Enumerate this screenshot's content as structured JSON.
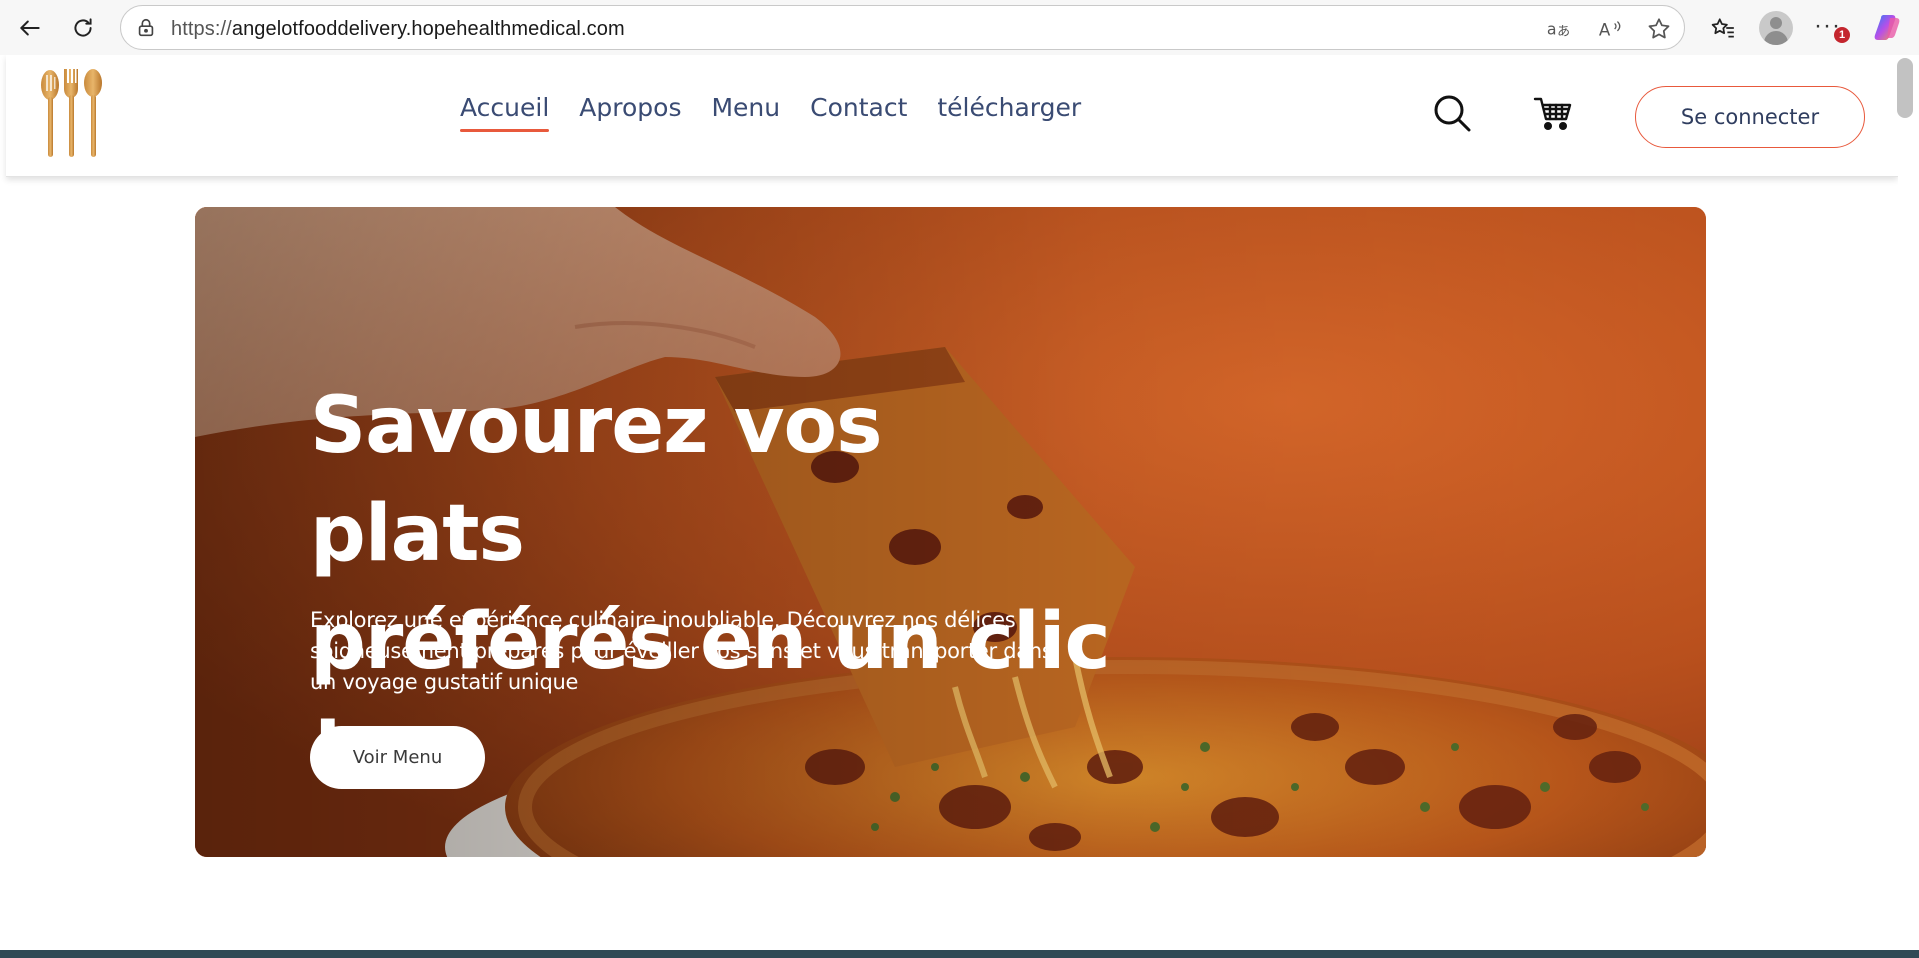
{
  "browser": {
    "url_prefix": "https://",
    "url_host": "angelotfooddelivery.hopehealthmedical.com",
    "notification_count": "1",
    "icons": [
      "back-icon",
      "refresh-icon",
      "lock-icon",
      "translate-icon",
      "read-aloud-icon",
      "favorite-star-icon",
      "favorites-icon",
      "profile-icon",
      "more-icon",
      "copilot-icon"
    ]
  },
  "header": {
    "nav": [
      "Accueil",
      "Apropos",
      "Menu",
      "Contact",
      "télécharger"
    ],
    "active_nav": "Accueil",
    "login_label": "Se connecter",
    "icons": [
      "utensils-logo",
      "search-icon",
      "cart-icon"
    ]
  },
  "hero": {
    "title_line1": "Savourez vos plats",
    "title_line2": "préférés en un clic !",
    "subtitle": "Explorez une expérience culinaire inoubliable. Découvrez nos délices soigneusement préparés pour éveiller vos sens et vous transporter dans un voyage gustatif unique",
    "button_label": "Voir Menu"
  },
  "colors": {
    "accent": "#e8593c",
    "nav_text": "#3a4b73",
    "hero_bg": "#c4541f"
  }
}
